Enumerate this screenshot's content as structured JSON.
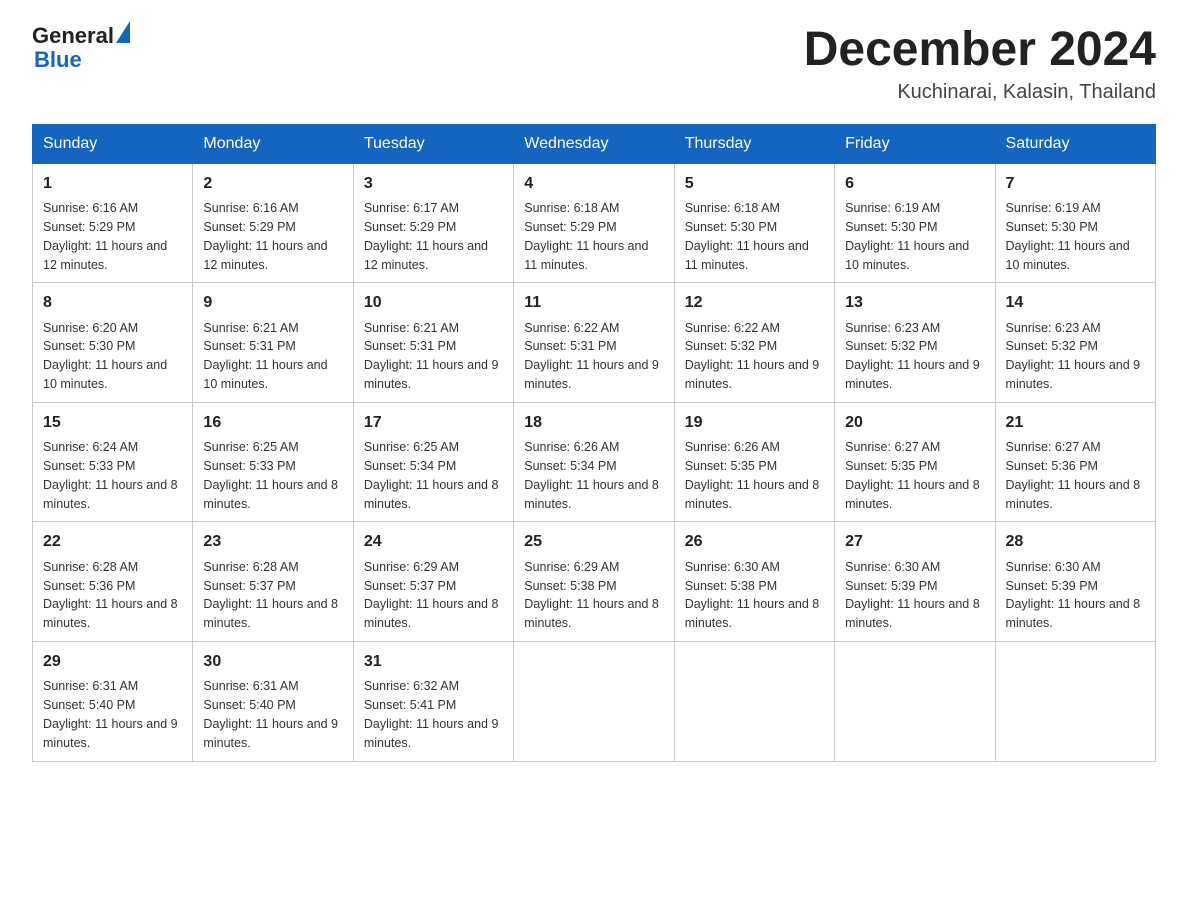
{
  "logo": {
    "general": "General",
    "blue": "Blue"
  },
  "header": {
    "month": "December 2024",
    "location": "Kuchinarai, Kalasin, Thailand"
  },
  "days_of_week": [
    "Sunday",
    "Monday",
    "Tuesday",
    "Wednesday",
    "Thursday",
    "Friday",
    "Saturday"
  ],
  "weeks": [
    [
      {
        "day": "1",
        "sunrise": "6:16 AM",
        "sunset": "5:29 PM",
        "daylight": "11 hours and 12 minutes."
      },
      {
        "day": "2",
        "sunrise": "6:16 AM",
        "sunset": "5:29 PM",
        "daylight": "11 hours and 12 minutes."
      },
      {
        "day": "3",
        "sunrise": "6:17 AM",
        "sunset": "5:29 PM",
        "daylight": "11 hours and 12 minutes."
      },
      {
        "day": "4",
        "sunrise": "6:18 AM",
        "sunset": "5:29 PM",
        "daylight": "11 hours and 11 minutes."
      },
      {
        "day": "5",
        "sunrise": "6:18 AM",
        "sunset": "5:30 PM",
        "daylight": "11 hours and 11 minutes."
      },
      {
        "day": "6",
        "sunrise": "6:19 AM",
        "sunset": "5:30 PM",
        "daylight": "11 hours and 10 minutes."
      },
      {
        "day": "7",
        "sunrise": "6:19 AM",
        "sunset": "5:30 PM",
        "daylight": "11 hours and 10 minutes."
      }
    ],
    [
      {
        "day": "8",
        "sunrise": "6:20 AM",
        "sunset": "5:30 PM",
        "daylight": "11 hours and 10 minutes."
      },
      {
        "day": "9",
        "sunrise": "6:21 AM",
        "sunset": "5:31 PM",
        "daylight": "11 hours and 10 minutes."
      },
      {
        "day": "10",
        "sunrise": "6:21 AM",
        "sunset": "5:31 PM",
        "daylight": "11 hours and 9 minutes."
      },
      {
        "day": "11",
        "sunrise": "6:22 AM",
        "sunset": "5:31 PM",
        "daylight": "11 hours and 9 minutes."
      },
      {
        "day": "12",
        "sunrise": "6:22 AM",
        "sunset": "5:32 PM",
        "daylight": "11 hours and 9 minutes."
      },
      {
        "day": "13",
        "sunrise": "6:23 AM",
        "sunset": "5:32 PM",
        "daylight": "11 hours and 9 minutes."
      },
      {
        "day": "14",
        "sunrise": "6:23 AM",
        "sunset": "5:32 PM",
        "daylight": "11 hours and 9 minutes."
      }
    ],
    [
      {
        "day": "15",
        "sunrise": "6:24 AM",
        "sunset": "5:33 PM",
        "daylight": "11 hours and 8 minutes."
      },
      {
        "day": "16",
        "sunrise": "6:25 AM",
        "sunset": "5:33 PM",
        "daylight": "11 hours and 8 minutes."
      },
      {
        "day": "17",
        "sunrise": "6:25 AM",
        "sunset": "5:34 PM",
        "daylight": "11 hours and 8 minutes."
      },
      {
        "day": "18",
        "sunrise": "6:26 AM",
        "sunset": "5:34 PM",
        "daylight": "11 hours and 8 minutes."
      },
      {
        "day": "19",
        "sunrise": "6:26 AM",
        "sunset": "5:35 PM",
        "daylight": "11 hours and 8 minutes."
      },
      {
        "day": "20",
        "sunrise": "6:27 AM",
        "sunset": "5:35 PM",
        "daylight": "11 hours and 8 minutes."
      },
      {
        "day": "21",
        "sunrise": "6:27 AM",
        "sunset": "5:36 PM",
        "daylight": "11 hours and 8 minutes."
      }
    ],
    [
      {
        "day": "22",
        "sunrise": "6:28 AM",
        "sunset": "5:36 PM",
        "daylight": "11 hours and 8 minutes."
      },
      {
        "day": "23",
        "sunrise": "6:28 AM",
        "sunset": "5:37 PM",
        "daylight": "11 hours and 8 minutes."
      },
      {
        "day": "24",
        "sunrise": "6:29 AM",
        "sunset": "5:37 PM",
        "daylight": "11 hours and 8 minutes."
      },
      {
        "day": "25",
        "sunrise": "6:29 AM",
        "sunset": "5:38 PM",
        "daylight": "11 hours and 8 minutes."
      },
      {
        "day": "26",
        "sunrise": "6:30 AM",
        "sunset": "5:38 PM",
        "daylight": "11 hours and 8 minutes."
      },
      {
        "day": "27",
        "sunrise": "6:30 AM",
        "sunset": "5:39 PM",
        "daylight": "11 hours and 8 minutes."
      },
      {
        "day": "28",
        "sunrise": "6:30 AM",
        "sunset": "5:39 PM",
        "daylight": "11 hours and 8 minutes."
      }
    ],
    [
      {
        "day": "29",
        "sunrise": "6:31 AM",
        "sunset": "5:40 PM",
        "daylight": "11 hours and 9 minutes."
      },
      {
        "day": "30",
        "sunrise": "6:31 AM",
        "sunset": "5:40 PM",
        "daylight": "11 hours and 9 minutes."
      },
      {
        "day": "31",
        "sunrise": "6:32 AM",
        "sunset": "5:41 PM",
        "daylight": "11 hours and 9 minutes."
      },
      null,
      null,
      null,
      null
    ]
  ]
}
